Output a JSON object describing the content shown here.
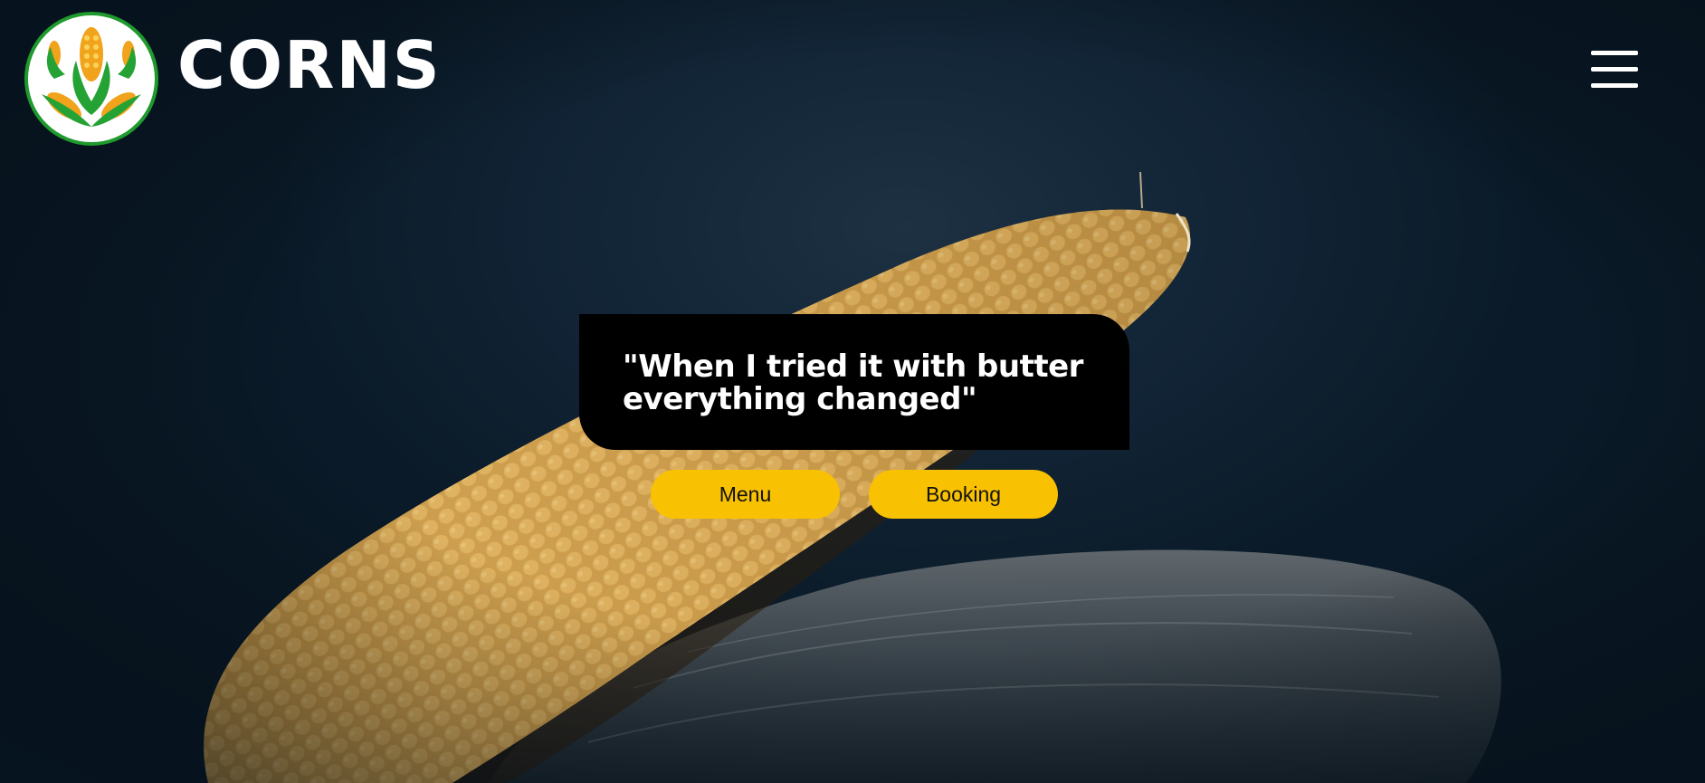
{
  "header": {
    "brand": "CORNS",
    "logo_icon": "corn-logo-icon",
    "menu_icon": "hamburger-menu-icon"
  },
  "hero": {
    "quote": "\"When I tried it with butter everything changed\"",
    "buttons": {
      "menu_label": "Menu",
      "booking_label": "Booking"
    },
    "background_image": "corn-cob-photo"
  },
  "colors": {
    "background": "#0c1b29",
    "accent": "#f8c102",
    "quote_box": "#000000",
    "logo_green": "#1f9a2c",
    "corn": "#e2b453"
  }
}
